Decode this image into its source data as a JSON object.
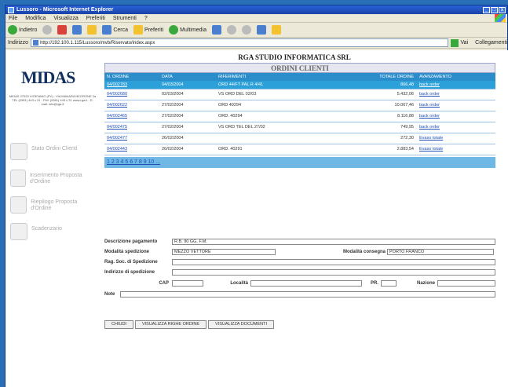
{
  "window": {
    "title": "Lussoro - Microsoft Internet Explorer"
  },
  "menu": [
    "File",
    "Modifica",
    "Visualizza",
    "Preferiti",
    "Strumenti",
    "?"
  ],
  "toolbar": {
    "back": "Indietro",
    "search": "Cerca",
    "favorites": "Preferiti",
    "multimedia": "Multimedia"
  },
  "address": {
    "label": "Indirizzo",
    "url": "http://192.100.1.115/Lussoro/mvb/Riservato/index.aspx",
    "go": "Vai",
    "links": "Collegamenti"
  },
  "sidebar": {
    "logo": "MIDAS",
    "logo_sub": "MIDAS 27029 VIGEVANO (PV) - VIA MANARA NEGRONE 2a TEL (0381) 443 x 31 - FAX (0381) 443 x 31 www.rga.it - E-mail: info@rga.it",
    "items": [
      {
        "label": "Stato Ordini Clienti"
      },
      {
        "label": "Inserimento Proposta d'Ordine"
      },
      {
        "label": "Riepilogo Proposta d'Ordine"
      },
      {
        "label": "Scadenzario"
      }
    ]
  },
  "main": {
    "company": "RGA STUDIO INFORMATICA SRL",
    "panel_title": "ORDINI CLIENTI",
    "columns": [
      "N. ORDINE",
      "DATA",
      "RIFERIMENTI",
      "TOTALE ORDINE",
      "AVANZAMENTO"
    ],
    "rows": [
      {
        "n": "04/002783",
        "data": "04/03/2004",
        "rif": "ORD 44/FT PAL R 4/41",
        "tot": "866,48",
        "av": "back order"
      },
      {
        "n": "04/002680",
        "data": "02/03/2004",
        "rif": "VS ORD DEL 02/03",
        "tot": "5.432,06",
        "av": "back order"
      },
      {
        "n": "04/002622",
        "data": "27/02/2004",
        "rif": "ORD 40294",
        "tot": "10.067,46",
        "av": "back order"
      },
      {
        "n": "04/002465",
        "data": "27/02/2004",
        "rif": "ORD. 40294",
        "tot": "8.116,88",
        "av": "back order"
      },
      {
        "n": "04/002475",
        "data": "27/02/2004",
        "rif": "VS ORD TEL DEL 27/02",
        "tot": "749,95",
        "av": "back order"
      },
      {
        "n": "04/002477",
        "data": "26/02/2004",
        "rif": "",
        "tot": "272,30",
        "av": "Evaso totale"
      },
      {
        "n": "04/002443",
        "data": "26/02/2004",
        "rif": "ORD. 40291",
        "tot": "2.883,54",
        "av": "Evaso totale"
      }
    ],
    "pager": "1 2 3 4 5 6 7 8 9 10 ..."
  },
  "form": {
    "pagamento_label": "Descrizione pagamento",
    "pagamento_value": "R.B. 90 GG. F.M.",
    "spedizione_label": "Modalità spedizione",
    "spedizione_value": "MEZZO VETTORE",
    "consegna_label": "Modalità consegna",
    "consegna_value": "PORTO FRANCO",
    "ragsoc_label": "Rag. Soc. di Spedizione",
    "indirizzo_label": "Indirizzo di spedizione",
    "cap_label": "CAP",
    "localita_label": "Località",
    "pr_label": "PR.",
    "nazione_label": "Nazione",
    "note_label": "Note"
  },
  "buttons": {
    "close": "CHIUDI",
    "righe": "VISUALIZZA RIGHE ORDINE",
    "documenti": "VISUALIZZA DOCUMENTI"
  }
}
